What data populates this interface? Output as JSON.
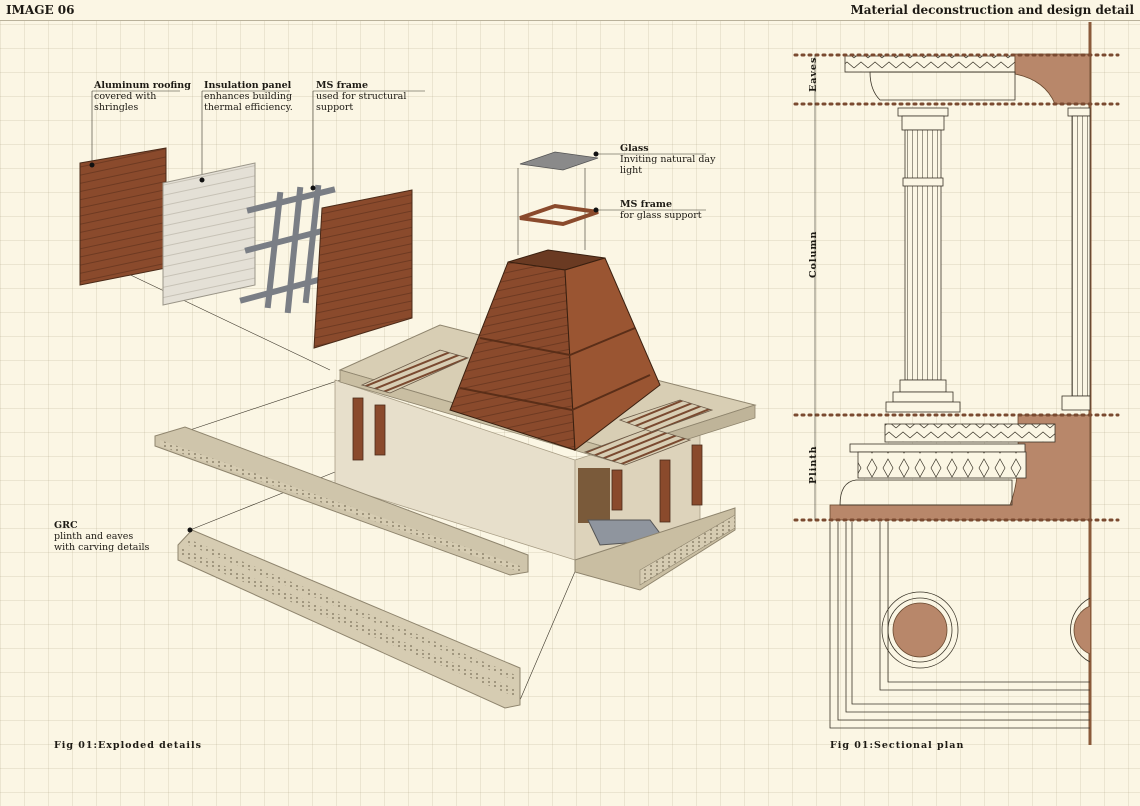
{
  "header": {
    "sheet_id": "IMAGE 06",
    "sheet_title": "Material deconstruction and design detail"
  },
  "exploded": {
    "labels": [
      {
        "title": "Aluminum roofing",
        "desc": "covered with shringles"
      },
      {
        "title": "Insulation panel",
        "desc": "enhances building thermal efficiency."
      },
      {
        "title": "MS frame",
        "desc": "used for structural support"
      },
      {
        "title": "Glass",
        "desc": "Inviting natural day light"
      },
      {
        "title": "MS frame",
        "desc": "for glass support"
      },
      {
        "title": "GRC",
        "desc": "plinth and eaves with carving details"
      }
    ],
    "caption": "Fig 01:Exploded details"
  },
  "section": {
    "zones": [
      "Eaves",
      "Column",
      "Plinth"
    ],
    "caption": "Fig 01:Sectional plan"
  },
  "colors": {
    "wood": "#8a4a2c",
    "wood_light": "#b5693e",
    "stone": "#d8ceb4",
    "stone_dark": "#a89d85",
    "steel": "#8d9096",
    "section_fill": "#b8876a",
    "paper": "#fbf6e4"
  }
}
